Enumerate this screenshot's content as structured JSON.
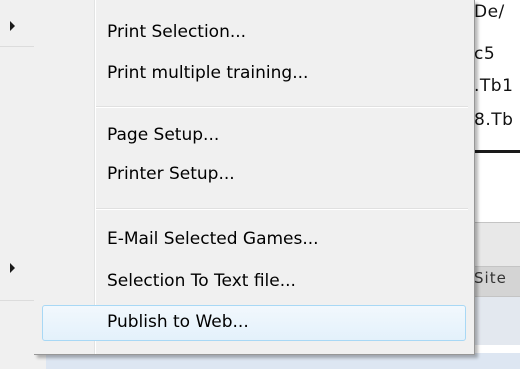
{
  "background": {
    "text_lines": [
      "De/",
      "c5",
      ".Tb1",
      "8.Tb"
    ],
    "cut_label": "Site"
  },
  "submenu": {
    "items": [
      {
        "label": "Print Selection..."
      },
      {
        "label": "Print multiple training..."
      },
      {
        "label": "Page Setup..."
      },
      {
        "label": "Printer Setup..."
      },
      {
        "label": "E-Mail Selected Games..."
      },
      {
        "label": "Selection To Text file..."
      },
      {
        "label": "Publish to Web..."
      }
    ],
    "hovered_item": "Publish to Web..."
  },
  "colors": {
    "menu_background": "#f0f0f0",
    "highlight_border": "#a8d8f5",
    "highlight_fill": "#e3f1fb"
  }
}
